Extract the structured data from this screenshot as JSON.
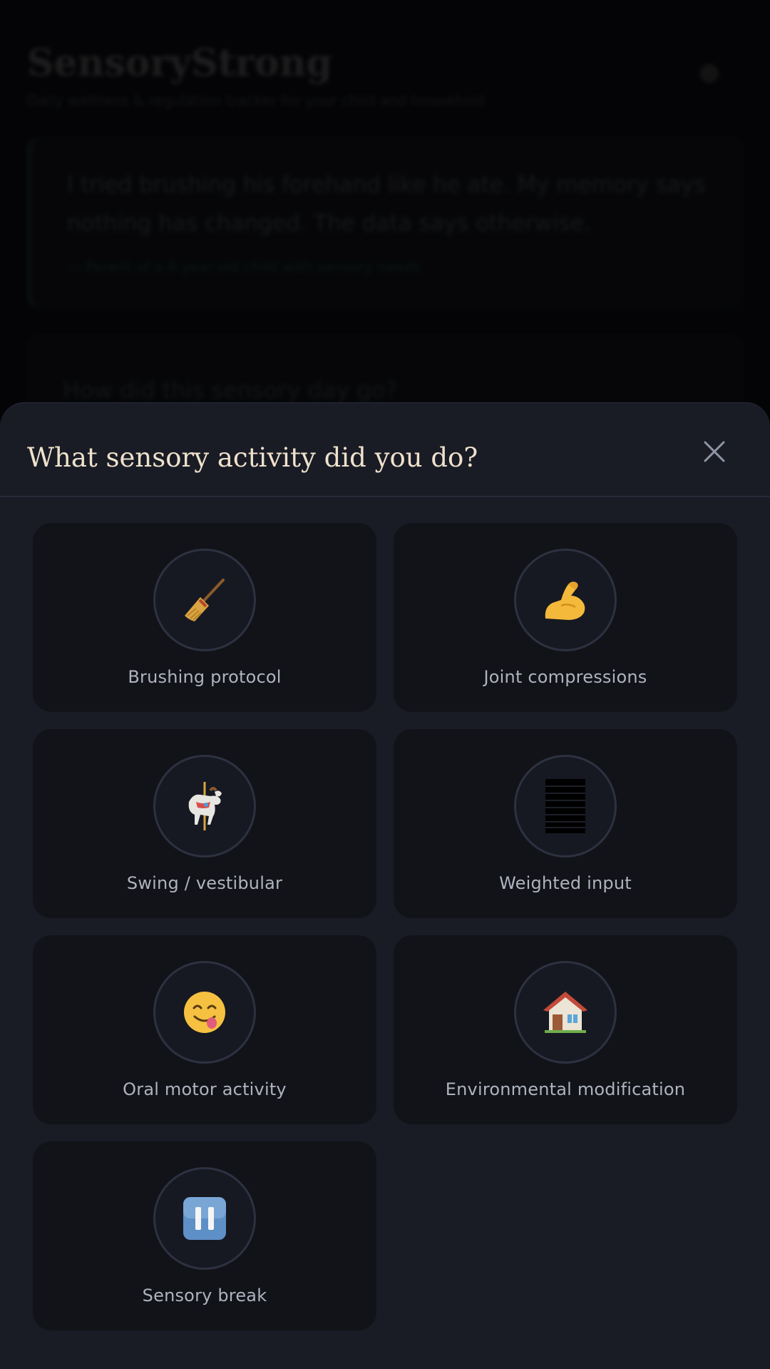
{
  "background": {
    "app_title": "SensoryStrong",
    "tagline": "Daily wellness & regulation tracker for your child and household",
    "quote": "I tried brushing his forehand like he ate. My memory says nothing has changed. The data says otherwise.",
    "quote_source": "— Parent of a 6-year-old child with sensory needs",
    "question": "How did this sensory day go?"
  },
  "sheet": {
    "title": "What sensory activity did you do?",
    "close_label": "Close",
    "activities": [
      {
        "label": "Brushing protocol",
        "icon": "broom-icon"
      },
      {
        "label": "Joint compressions",
        "icon": "flexed-biceps-icon"
      },
      {
        "label": "Swing / vestibular",
        "icon": "carousel-horse-icon"
      },
      {
        "label": "Weighted input",
        "icon": "weight-blanket-icon"
      },
      {
        "label": "Oral motor activity",
        "icon": "face-savoring-food-icon"
      },
      {
        "label": "Environmental modification",
        "icon": "house-icon"
      },
      {
        "label": "Sensory break",
        "icon": "pause-button-icon"
      }
    ]
  },
  "colors": {
    "sheet_bg": "#191c25",
    "tile_bg": "#111318",
    "title": "#efe1cc",
    "label": "#aeb3bf",
    "circle_border": "#2d3140"
  }
}
